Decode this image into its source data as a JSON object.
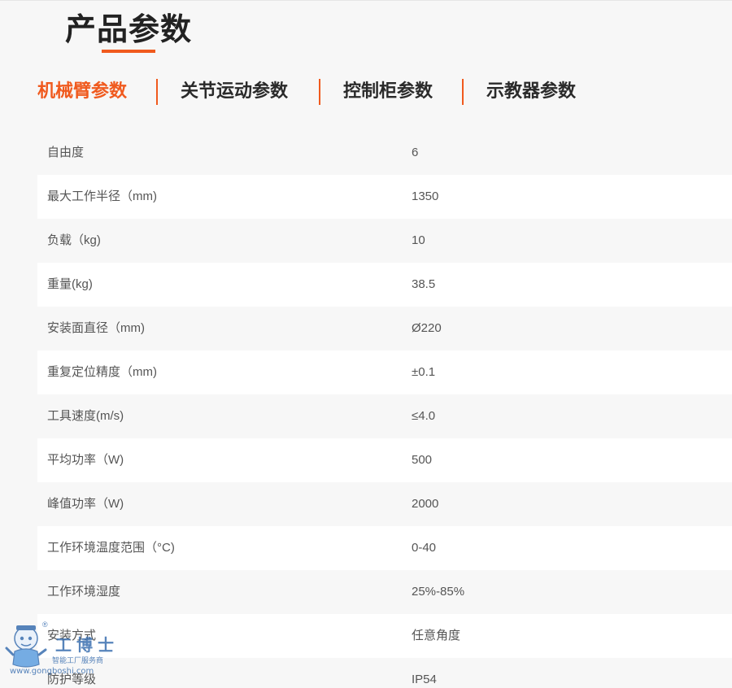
{
  "header": {
    "title": "产品参数"
  },
  "tabs": [
    {
      "label": "机械臂参数",
      "active": true
    },
    {
      "label": "关节运动参数",
      "active": false
    },
    {
      "label": "控制柜参数",
      "active": false
    },
    {
      "label": "示教器参数",
      "active": false
    }
  ],
  "specs": [
    {
      "label": "自由度",
      "value": "6"
    },
    {
      "label": "最大工作半径（mm)",
      "value": "1350"
    },
    {
      "label": "负载（kg)",
      "value": "10"
    },
    {
      "label": "重量(kg)",
      "value": "38.5"
    },
    {
      "label": "安装面直径（mm)",
      "value": "Ø220"
    },
    {
      "label": "重复定位精度（mm)",
      "value": "±0.1"
    },
    {
      "label": "工具速度(m/s)",
      "value": "≤4.0"
    },
    {
      "label": "平均功率（W)",
      "value": "500"
    },
    {
      "label": "峰值功率（W)",
      "value": "2000"
    },
    {
      "label": "工作环境温度范围（°C)",
      "value": "0-40"
    },
    {
      "label": "工作环境湿度",
      "value": "25%-85%"
    },
    {
      "label": "安装方式",
      "value": "任意角度"
    },
    {
      "label": "防护等级",
      "value": "IP54"
    }
  ],
  "watermark": {
    "brand": "工博士",
    "tagline": "智能工厂服务商",
    "url": "www.gongboshi.com",
    "reg": "®"
  },
  "colors": {
    "accent": "#f05a1e",
    "watermark": "#3a6fb0"
  }
}
